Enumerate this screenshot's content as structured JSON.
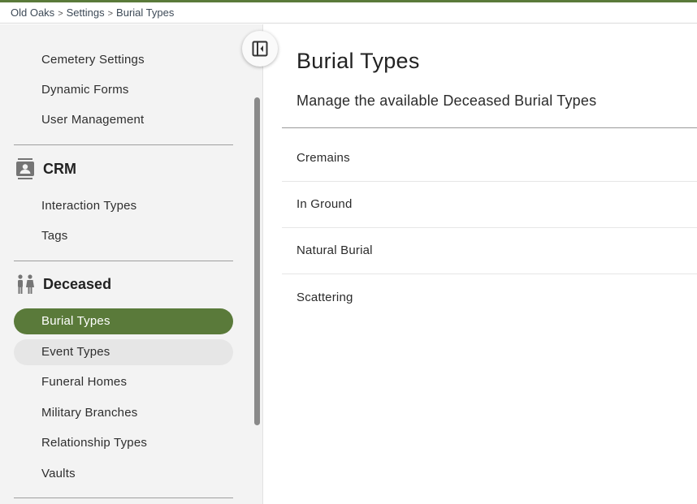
{
  "breadcrumb": {
    "items": [
      "Old Oaks",
      "Settings",
      "Burial Types"
    ],
    "separator": ">"
  },
  "sidebar": {
    "top_items": [
      {
        "label": "Cemetery Settings"
      },
      {
        "label": "Dynamic Forms"
      },
      {
        "label": "User Management"
      }
    ],
    "sections": [
      {
        "title": "CRM",
        "icon": "contact-book-icon",
        "items": [
          {
            "label": "Interaction Types"
          },
          {
            "label": "Tags"
          }
        ]
      },
      {
        "title": "Deceased",
        "icon": "people-icon",
        "items": [
          {
            "label": "Burial Types",
            "state": "active"
          },
          {
            "label": "Event Types",
            "state": "hover"
          },
          {
            "label": "Funeral Homes"
          },
          {
            "label": "Military Branches"
          },
          {
            "label": "Relationship Types"
          },
          {
            "label": "Vaults"
          }
        ]
      }
    ],
    "collapse_icon": "sidebar-collapse-icon"
  },
  "main": {
    "title": "Burial Types",
    "subtitle": "Manage the available Deceased Burial Types",
    "rows": [
      "Cremains",
      "In Ground",
      "Natural Burial",
      "Scattering"
    ]
  },
  "colors": {
    "accent": "#5a7a3a",
    "sidebar_bg": "#f3f3f3",
    "hover_bg": "#e6e6e6"
  }
}
